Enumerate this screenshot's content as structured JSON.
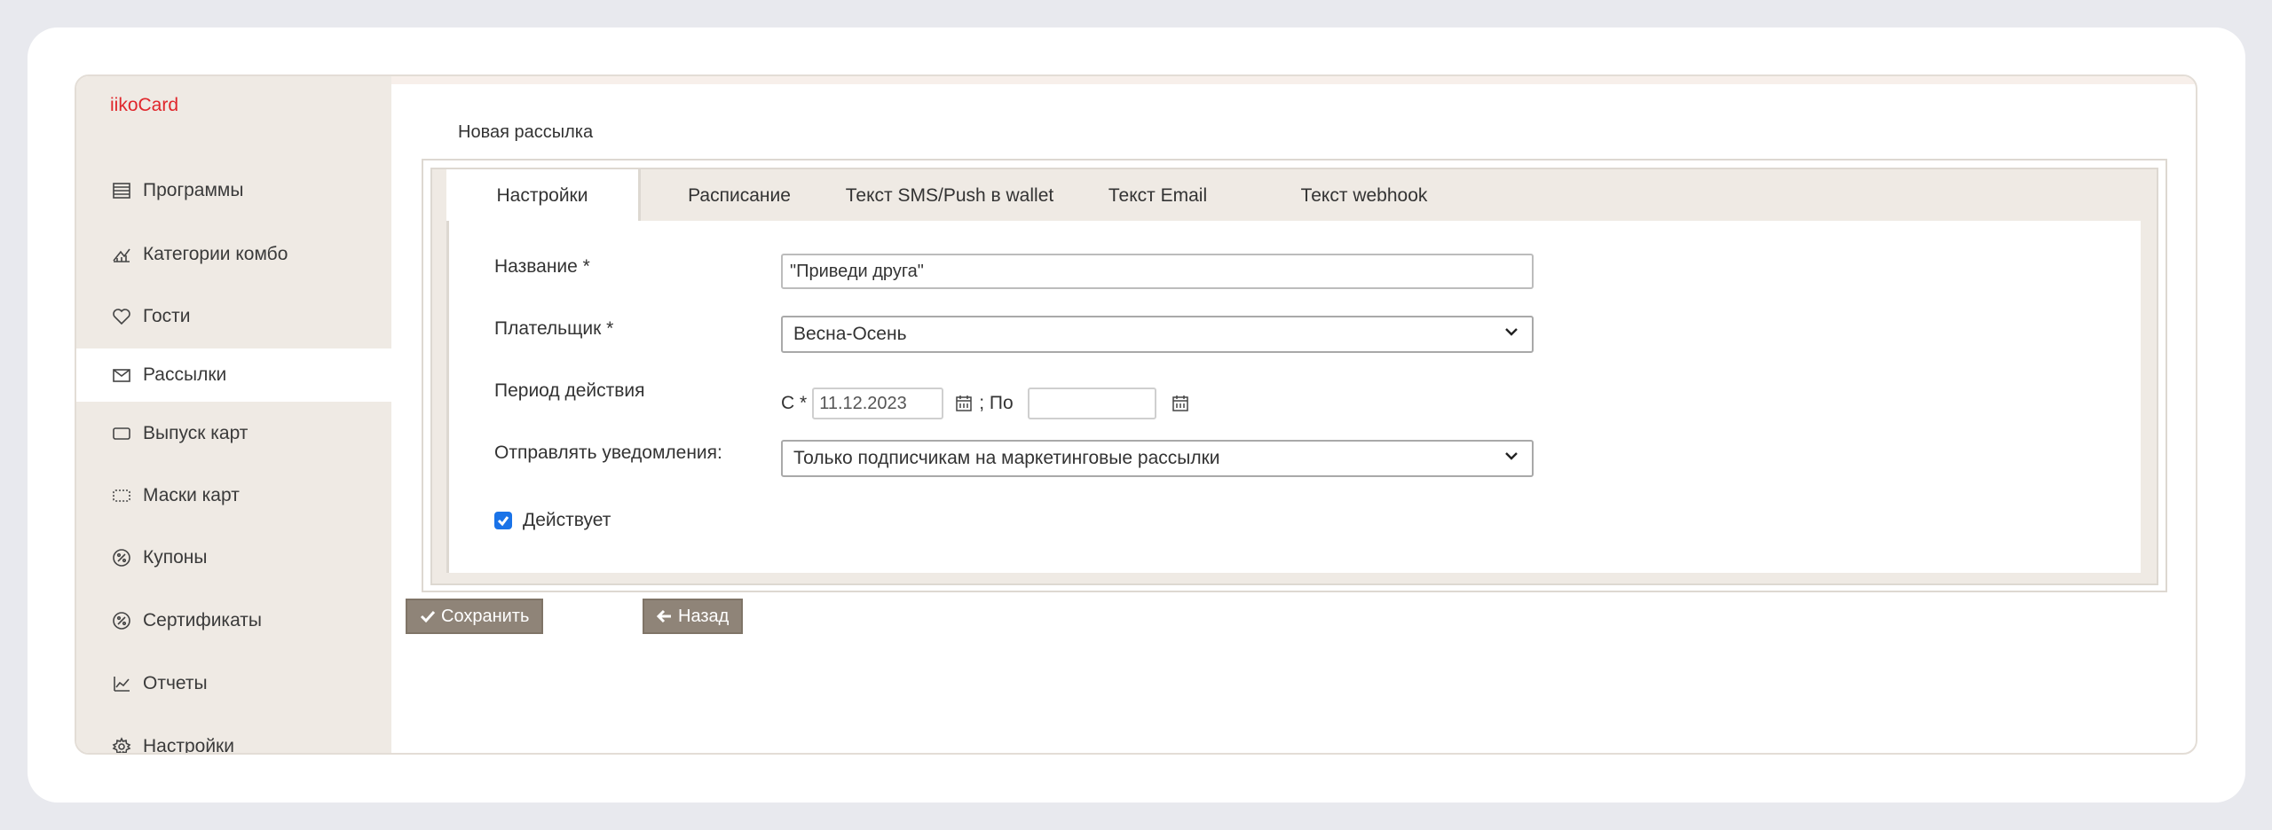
{
  "app": {
    "brand": "iikoCard"
  },
  "sidebar": {
    "items": [
      {
        "label": "Программы",
        "icon": "list-icon"
      },
      {
        "label": "Категории комбо",
        "icon": "category-icon"
      },
      {
        "label": "Гости",
        "icon": "heart-icon"
      },
      {
        "label": "Рассылки",
        "icon": "mail-icon",
        "active": true
      },
      {
        "label": "Выпуск карт",
        "icon": "card-icon"
      },
      {
        "label": "Маски карт",
        "icon": "mask-icon"
      },
      {
        "label": "Купоны",
        "icon": "percent-icon"
      },
      {
        "label": "Сертификаты",
        "icon": "percent-icon"
      },
      {
        "label": "Отчеты",
        "icon": "chart-icon"
      },
      {
        "label": "Настройки",
        "icon": "gear-icon"
      }
    ]
  },
  "page": {
    "title": "Новая рассылка"
  },
  "tabs": [
    {
      "label": "Настройки",
      "active": true
    },
    {
      "label": "Расписание"
    },
    {
      "label": "Текст SMS/Push в wallet"
    },
    {
      "label": "Текст Email"
    },
    {
      "label": "Текст webhook"
    }
  ],
  "form": {
    "name_label": "Название *",
    "name_value": "\"Приведи друга\"",
    "payer_label": "Плательщик *",
    "payer_value": "Весна-Осень",
    "period_label": "Период действия",
    "period_from_label": "С *",
    "period_from_value": "11.12.2023",
    "period_to_label": "; По",
    "period_to_value": "",
    "notify_label": "Отправлять уведомления:",
    "notify_value": "Только подписчикам на маркетинговые рассылки",
    "active_label": "Действует",
    "active_checked": true
  },
  "buttons": {
    "save": "Сохранить",
    "back": "Назад"
  },
  "colors": {
    "brand": "#e0262b",
    "sidebar_bg": "#efeae4",
    "button_bg": "#8f8478",
    "checkbox": "#1a73e8"
  }
}
